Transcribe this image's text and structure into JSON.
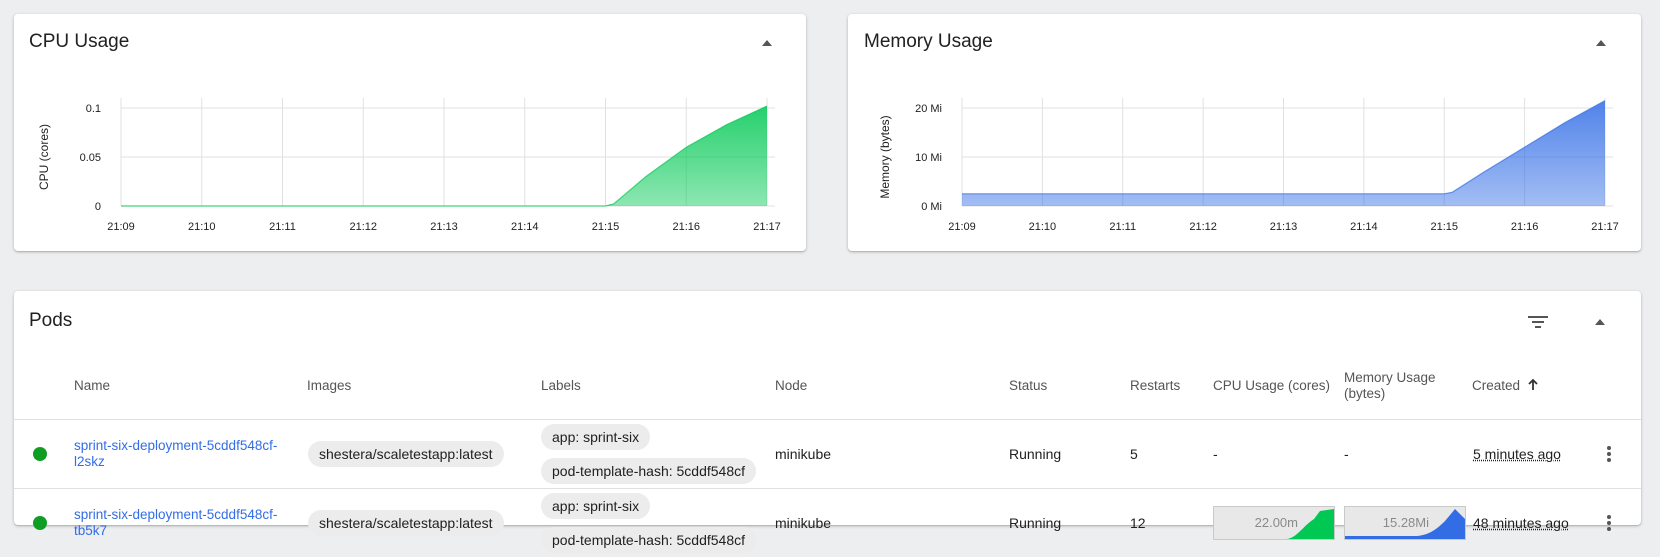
{
  "cpu_card": {
    "title": "CPU Usage",
    "chart_data": {
      "type": "area",
      "ylabel": "CPU (cores)",
      "x": [
        "21:09",
        "21:10",
        "21:11",
        "21:12",
        "21:13",
        "21:14",
        "21:15",
        "21:16",
        "21:17"
      ],
      "y_ticks": [
        "0",
        "0.05",
        "0.1"
      ],
      "ylim": [
        0,
        0.1
      ],
      "series": [
        {
          "values": [
            0,
            0,
            0,
            0,
            0,
            0,
            0,
            0.06,
            0.102
          ],
          "x_points": [
            0,
            1,
            2,
            3,
            4,
            5,
            6,
            6.1,
            6.5,
            7,
            7.5,
            8
          ],
          "y_points": [
            0,
            0,
            0,
            0,
            0,
            0,
            0,
            0.002,
            0.03,
            0.06,
            0.083,
            0.102
          ],
          "color": "#00c853"
        }
      ]
    }
  },
  "mem_card": {
    "title": "Memory Usage",
    "chart_data": {
      "type": "area",
      "ylabel": "Memory (bytes)",
      "x": [
        "21:09",
        "21:10",
        "21:11",
        "21:12",
        "21:13",
        "21:14",
        "21:15",
        "21:16",
        "21:17"
      ],
      "y_ticks": [
        "0 Mi",
        "10 Mi",
        "20 Mi"
      ],
      "ylim": [
        0,
        20
      ],
      "series": [
        {
          "x_points": [
            0,
            1,
            2,
            3,
            4,
            5,
            6,
            6.1,
            6.5,
            7,
            7.5,
            8
          ],
          "y_points": [
            2.5,
            2.5,
            2.5,
            2.5,
            2.5,
            2.5,
            2.5,
            2.8,
            7,
            12,
            17,
            21.5
          ],
          "color": "#326de6"
        }
      ]
    }
  },
  "pods": {
    "title": "Pods",
    "columns": {
      "name": "Name",
      "images": "Images",
      "labels": "Labels",
      "node": "Node",
      "status": "Status",
      "restarts": "Restarts",
      "cpu_l1": "CPU Usage (cores)",
      "mem_l1": "Memory Usage",
      "mem_l2": "(bytes)",
      "created": "Created"
    },
    "rows": [
      {
        "name_l1": "sprint-six-deployment-5cddf548cf-",
        "name_l2": "l2skz",
        "image": "shestera/scaletestapp:latest",
        "label1": "app: sprint-six",
        "label2": "pod-template-hash: 5cddf548cf",
        "node": "minikube",
        "status": "Running",
        "restarts": "5",
        "cpu": "-",
        "memory": "-",
        "created": "5 minutes ago"
      },
      {
        "name_l1": "sprint-six-deployment-5cddf548cf-",
        "name_l2": "tb5k7",
        "image": "shestera/scaletestapp:latest",
        "label1": "app: sprint-six",
        "label2": "pod-template-hash: 5cddf548cf",
        "node": "minikube",
        "status": "Running",
        "restarts": "12",
        "cpu": "22.00m",
        "memory": "15.28Mi",
        "created": "48 minutes ago"
      }
    ]
  },
  "colors": {
    "accent": "#326de6",
    "running": "#0f9d24",
    "cpu_area": "#00c853",
    "mem_area": "#326de6"
  }
}
